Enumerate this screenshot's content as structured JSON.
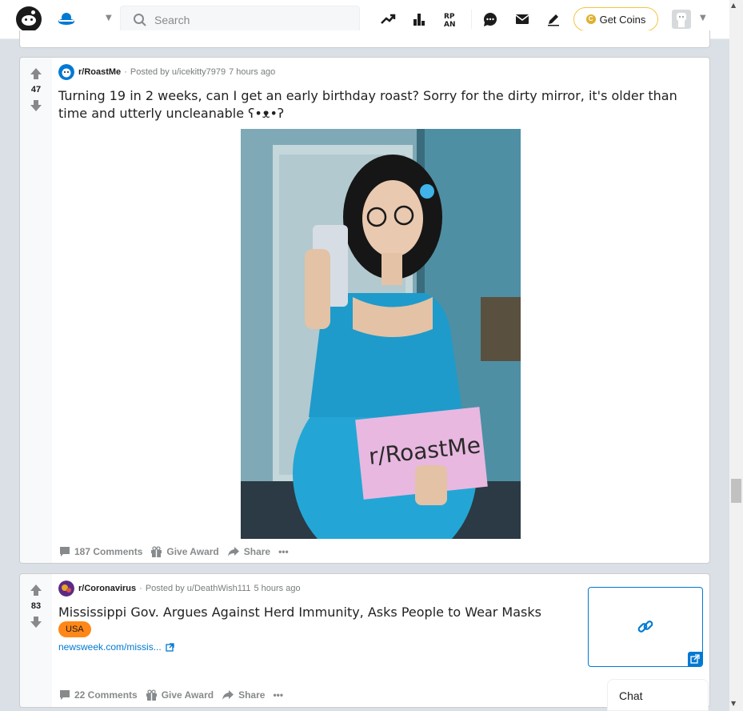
{
  "header": {
    "search_placeholder": "Search",
    "get_coins_label": "Get Coins",
    "coin_symbol": "C"
  },
  "posts": [
    {
      "score": "47",
      "subreddit": "r/RoastMe",
      "posted_by": "Posted by u/icekitty7979",
      "time": "7 hours ago",
      "title": "Turning 19 in 2 weeks, can I get an early birthday roast? Sorry for the dirty mirror, it's older than time and utterly uncleanable ʕ•ᴥ•ʔ",
      "image_sign_text": "r/RoastMe",
      "comments": "187 Comments",
      "give_award": "Give Award",
      "share": "Share",
      "more": "•••"
    },
    {
      "score": "83",
      "subreddit": "r/Coronavirus",
      "posted_by": "Posted by u/DeathWish111",
      "time": "5 hours ago",
      "title": "Mississippi Gov. Argues Against Herd Immunity, Asks People to Wear Masks",
      "flair": "USA",
      "link_text": "newsweek.com/missis...",
      "comments": "22 Comments",
      "give_award": "Give Award",
      "share": "Share",
      "more": "•••"
    }
  ],
  "chat": {
    "label": "Chat"
  },
  "colors": {
    "accent": "#0079d3",
    "flair": "#ff8717",
    "coins_border": "#f4c542",
    "page_bg": "#dae0e6"
  },
  "icons": [
    "reddit-logo",
    "home-icon",
    "search-icon",
    "trending-icon",
    "leaderboard-icon",
    "rpan-icon",
    "chat-icon",
    "mail-icon",
    "pencil-icon",
    "coin-icon",
    "upvote-icon",
    "downvote-icon",
    "comment-icon",
    "gift-icon",
    "share-icon",
    "external-link-icon",
    "link-icon"
  ]
}
